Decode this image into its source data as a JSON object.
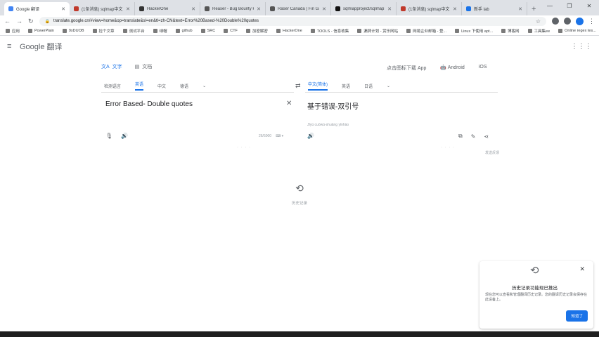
{
  "browser": {
    "tabs": [
      {
        "label": "Google 翻译",
        "active": true
      },
      {
        "label": "(1条消息) sqlmap中文...",
        "active": false
      },
      {
        "label": "HackerOne",
        "active": false
      },
      {
        "label": "Reaser - Bug Bounty Prog...",
        "active": false
      },
      {
        "label": "Raser Canada | Fin Game",
        "active": false
      },
      {
        "label": "sqlmapproject/sqlmap: A...",
        "active": false
      },
      {
        "label": "(1条消息) sqlmap中文...",
        "active": false
      },
      {
        "label": "新手 lab",
        "active": false
      }
    ],
    "new_tab": "+",
    "window_controls": {
      "minimize": "—",
      "maximize": "❐",
      "close": "✕"
    },
    "url": "translate.google.cn/#view=home&op=translate&sl=en&tl=zh-CN&text=Error%20Based-%20Double%20quotes",
    "nav": {
      "back": "←",
      "forward": "→",
      "reload": "↻"
    }
  },
  "bookmarks": [
    "应用",
    "PowerPlain",
    "9xDUOB",
    "捡个文章",
    "测试平台",
    "绿帽",
    "github",
    "SRC",
    "CTF",
    "加密解密",
    "HackerOne",
    "TOOLS - 信息收集",
    "漏洞计划 - 赏乐网站",
    "网易企业邮箱 - 登...",
    "Linux 下使用 apt...",
    "博客网",
    "工具集ee",
    "Online regex tes..."
  ],
  "gt_header": {
    "menu": "≡",
    "logo": "Google 翻译",
    "apps": "⋮⋮⋮"
  },
  "modes": {
    "text": "文字",
    "docs": "文档"
  },
  "app_links": {
    "download": "点击图标下载 App",
    "android": "Android",
    "ios": "iOS"
  },
  "source_langs": {
    "detect": "检测语言",
    "l1": "英语",
    "l2": "中文",
    "l3": "德语"
  },
  "target_langs": {
    "l1": "中文(简体)",
    "l2": "英语",
    "l3": "日语"
  },
  "source_text": "Error Based- Double quotes",
  "translated_text": "基于错误-双引号",
  "transliteration": "Jīyú cuòwù-shuāng yǐnhào",
  "source_meta": {
    "count": "26/5000",
    "keyboard": "⌨ ▾"
  },
  "feedback": "发送反馈",
  "history": {
    "label": "历史记录"
  },
  "popup": {
    "title": "历史记录功能现已推出",
    "body": "现在您可以查看和管理翻译历史记录。您的翻译历史记录会保存在此设备上。",
    "button": "知道了",
    "close": "✕"
  },
  "colors": {
    "accent": "#1a73e8",
    "text": "#202124",
    "muted": "#5f6368"
  }
}
